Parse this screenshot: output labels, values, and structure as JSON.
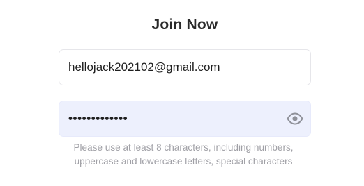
{
  "form": {
    "title": "Join Now",
    "email": {
      "value": "hellojack202102@gmail.com"
    },
    "password": {
      "masked_value": "•••••••••••••",
      "toggle_icon": "eye-icon"
    },
    "hint_line1": "Please use at least 8 characters, including numbers,",
    "hint_line2": "uppercase and lowercase letters, special characters"
  },
  "colors": {
    "password_bg": "#edf0fd",
    "hint_text": "#a0a0a6",
    "title_text": "#2a2a2a"
  }
}
